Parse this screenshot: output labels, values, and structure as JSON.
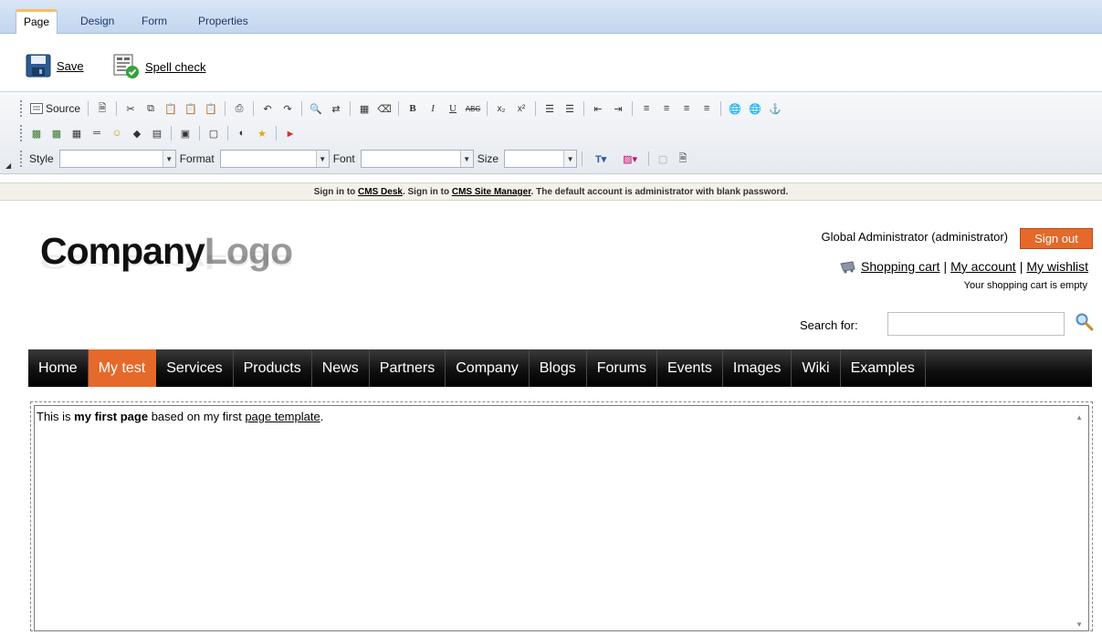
{
  "tabs": [
    "Page",
    "Design",
    "Form",
    "Properties"
  ],
  "actions": {
    "save": "Save",
    "spell_check": "Spell check"
  },
  "toolbar": {
    "source": "Source",
    "style_label": "Style",
    "format_label": "Format",
    "font_label": "Font",
    "size_label": "Size"
  },
  "infobar": {
    "sign_in": "Sign in to",
    "cms_desk": "CMS Desk",
    "sign_in2": ". Sign in to",
    "site_manager": "CMS Site Manager",
    "suffix": ". The default account is administrator with blank password."
  },
  "header": {
    "logo_dark": "Company",
    "logo_light": "Logo",
    "user": "Global Administrator (administrator)",
    "sign_out": "Sign out",
    "shopping_cart": "Shopping cart",
    "my_account": "My account",
    "my_wishlist": "My wishlist",
    "separator": "|",
    "cart_status": "Your shopping cart is empty",
    "search_label": "Search for:"
  },
  "menu": [
    "Home",
    "My test",
    "Services",
    "Products",
    "News",
    "Partners",
    "Company",
    "Blogs",
    "Forums",
    "Events",
    "Images",
    "Wiki",
    "Examples"
  ],
  "content": {
    "prefix": "This is ",
    "bold": "my first page",
    "middle": " based on my first ",
    "link": "page template",
    "suffix": "."
  },
  "colors": {
    "accent": "#e5692a",
    "menu_bg": "#111111",
    "tabbar": "#c3d6ee"
  }
}
